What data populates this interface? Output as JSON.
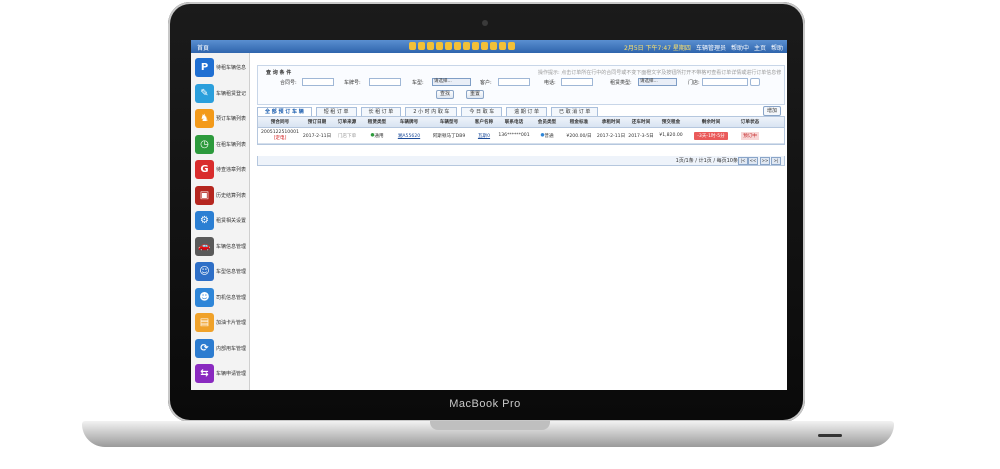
{
  "laptop": {
    "brand_label": "MacBook Pro"
  },
  "topbar": {
    "home": "首頁",
    "date_time": "2月5日 下午7:47 星期四",
    "links": [
      "车辆管理员",
      "帮助中",
      "主页",
      "帮助"
    ]
  },
  "sidebar": {
    "items": [
      {
        "label": "待租车辆信息",
        "icon": "parking-icon",
        "color": "#1f6fd2",
        "glyph": "P"
      },
      {
        "label": "车辆租赁登记",
        "icon": "register-icon",
        "color": "#2b9fdc",
        "glyph": "✎"
      },
      {
        "label": "预订车辆列表",
        "icon": "horse-icon",
        "color": "#f39a1a",
        "glyph": "♞"
      },
      {
        "label": "在租车辆列表",
        "icon": "clock-icon",
        "color": "#2c9a3c",
        "glyph": "◷"
      },
      {
        "label": "待查违章列表",
        "icon": "shield-icon",
        "color": "#d92d2d",
        "glyph": "G"
      },
      {
        "label": "历史结算列表",
        "icon": "archive-icon",
        "color": "#b5261f",
        "glyph": "▣"
      },
      {
        "label": "租赁相关设置",
        "icon": "gear-icon",
        "color": "#2b7fd3",
        "glyph": "⚙"
      },
      {
        "label": "车辆信息管理",
        "icon": "car-icon",
        "color": "#5a5a5a",
        "glyph": "🚗"
      },
      {
        "label": "车型信息管理",
        "icon": "finder-icon",
        "color": "#2e6fc7",
        "glyph": "☺"
      },
      {
        "label": "司机信息管理",
        "icon": "person-icon",
        "color": "#2f86d8",
        "glyph": "☻"
      },
      {
        "label": "加油卡片管理",
        "icon": "card-icon",
        "color": "#f0a22a",
        "glyph": "▤"
      },
      {
        "label": "内部用车管理",
        "icon": "rotate-icon",
        "color": "#2c7cd0",
        "glyph": "⟳"
      },
      {
        "label": "车辆申请管理",
        "icon": "request-icon",
        "color": "#8a2ac0",
        "glyph": "⇆"
      }
    ]
  },
  "query": {
    "title": "查 询 条 件",
    "hint": "操作提示: 点击订单所在行中的合同号或不变下面橙文字及按钮所打开不带格可查看订单详情或进行订单信息修",
    "labels": {
      "contract": "合同号:",
      "plate": "车牌号:",
      "car_type": "车型:",
      "customer": "客户:",
      "phone": "电话:",
      "lease_type": "租赁类型:",
      "store": "门店:"
    },
    "select_placeholder": "请选择...",
    "search_button": "查找",
    "reset_button": "重置"
  },
  "tabs": [
    {
      "label": "全 部 预 订 车 辆",
      "active": true
    },
    {
      "label": "短 租 订 单",
      "active": false
    },
    {
      "label": "长 租 订 单",
      "active": false
    },
    {
      "label": "2 小 时 内 取 车",
      "active": false
    },
    {
      "label": "今 日 取 车",
      "active": false
    },
    {
      "label": "逾 期 订 单",
      "active": false
    },
    {
      "label": "已 取 消 订 单",
      "active": false
    }
  ],
  "add_button": "增加",
  "table": {
    "headers": [
      "预合同号",
      "预订日期",
      "订单来源",
      "租赁类型",
      "车辆牌号",
      "车辆型号",
      "客户名称",
      "联系电话",
      "会员类型",
      "租金标准",
      "承租时间",
      "还车时间",
      "预交租金",
      "剩余时间",
      "订单状态"
    ],
    "rows": [
      {
        "contract": "2005122510001",
        "contract_note": "[定电]",
        "order_date": "2017-2-11日",
        "source": "门店下单",
        "lease_type": "通用",
        "plate": "湘A55620",
        "model": "阿斯顿马丁DB9",
        "customer": "瓦斯0",
        "phone": "136******001",
        "member": "普通",
        "rate": "¥200.00/日",
        "rent_start": "2017-2-11日",
        "return_time": "2017-3-5日",
        "prepaid": "¥1,820.00",
        "remaining": "-3天-1时-5分",
        "status": "预订中"
      }
    ]
  },
  "pager": {
    "text": "1页/1条 / 计1页 / 每页10条",
    "buttons": [
      "|<",
      "<<",
      ">>",
      ">|"
    ]
  }
}
